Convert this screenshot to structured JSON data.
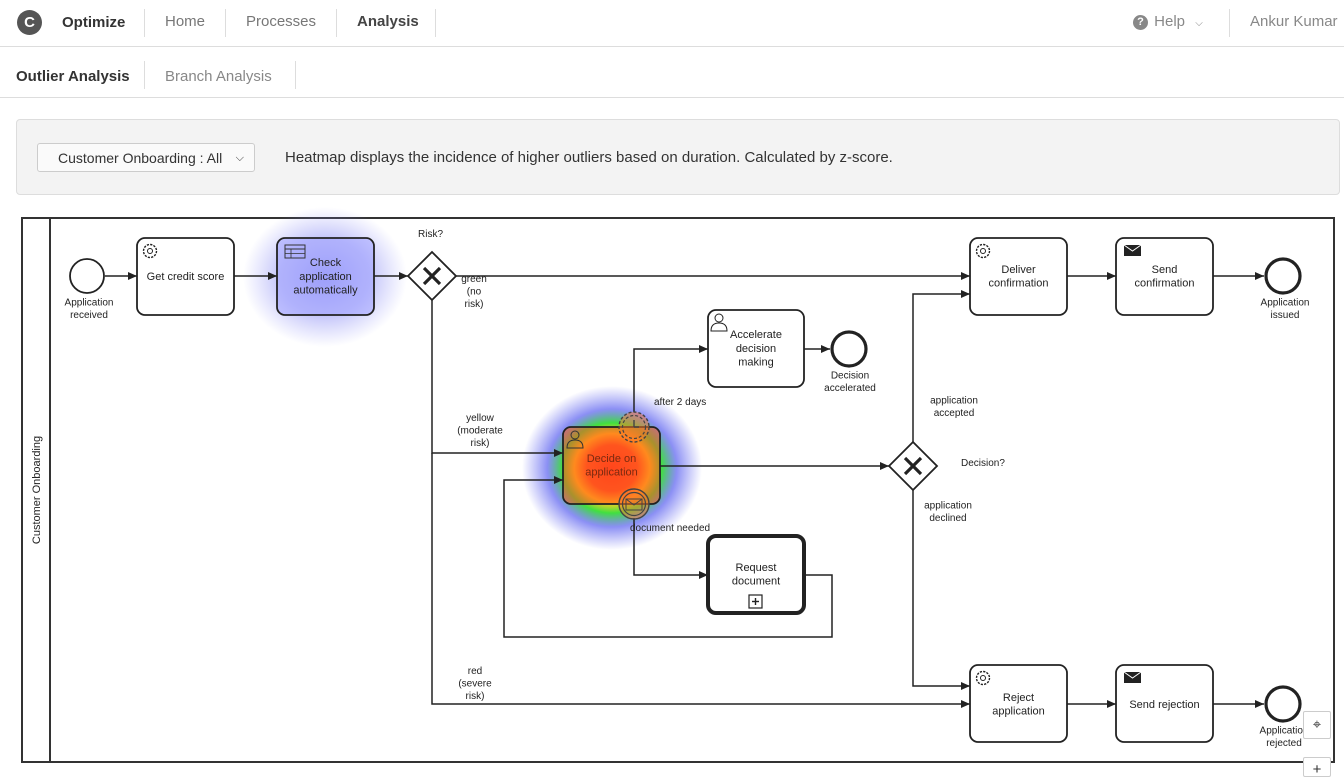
{
  "header": {
    "logo": "C",
    "brand": "Optimize",
    "nav": [
      {
        "label": "Home"
      },
      {
        "label": "Processes"
      },
      {
        "label": "Analysis"
      }
    ],
    "help": "Help",
    "user": "Ankur Kumar"
  },
  "subnav": {
    "tabs": [
      {
        "label": "Outlier Analysis"
      },
      {
        "label": "Branch Analysis"
      }
    ]
  },
  "controls": {
    "process_select": "Customer Onboarding : All",
    "description": "Heatmap displays the incidence of higher outliers based on duration. Calculated by z-score."
  },
  "diagram": {
    "pool": "Customer Onboarding",
    "events": {
      "start": "Application received",
      "end_issued": "Application issued",
      "end_accelerated": "Decision accelerated",
      "end_rejected": "Application rejected"
    },
    "tasks": {
      "credit": "Get credit score",
      "check": "Check application automatically",
      "deliver": "Deliver confirmation",
      "send_conf": "Send confirmation",
      "accelerate": "Accelerate decision making",
      "decide": "Decide on application",
      "request": "Request document",
      "reject": "Reject application",
      "send_rej": "Send rejection"
    },
    "gateways": {
      "risk": "Risk?",
      "decision": "Decision?"
    },
    "flows": {
      "green": "green (no risk)",
      "yellow": "yellow (moderate risk)",
      "red": "red (severe risk)",
      "after": "after 2 days",
      "doc": "document needed",
      "accepted": "application accepted",
      "declined": "application declined"
    }
  },
  "heatmap": {
    "check": 0.3,
    "decide": 1.0
  },
  "zoom_controls": {
    "fit": "⌖",
    "zoom_in": "+"
  }
}
